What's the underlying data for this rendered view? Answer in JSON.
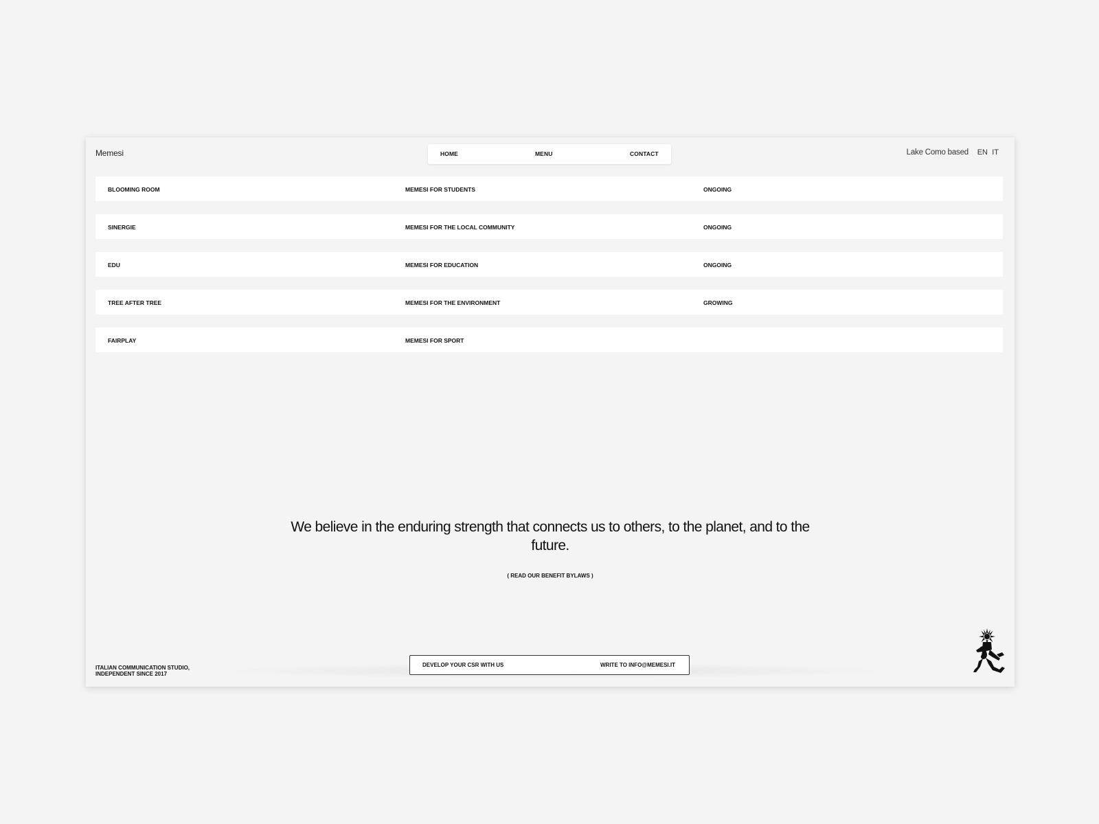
{
  "header": {
    "brand": "Memesi",
    "nav": {
      "home": "HOME",
      "menu": "MENU",
      "contact": "CONTACT"
    },
    "location": "Lake Como based",
    "languages": {
      "en": "EN",
      "it": "IT"
    }
  },
  "projects": [
    {
      "name": "BLOOMING ROOM",
      "category": "MEMESI FOR STUDENTS",
      "status": "ONGOING"
    },
    {
      "name": "SINERGIE",
      "category": "MEMESI FOR THE LOCAL COMMUNITY",
      "status": "ONGOING"
    },
    {
      "name": "EDU",
      "category": "MEMESI FOR EDUCATION",
      "status": "ONGOING"
    },
    {
      "name": "TREE AFTER TREE",
      "category": "MEMESI FOR THE ENVIRONMENT",
      "status": "GROWING"
    },
    {
      "name": "FAIRPLAY",
      "category": "MEMESI FOR SPORT",
      "status": ""
    }
  ],
  "statement": {
    "text": "We believe in the enduring strength that connects us to others, to the planet, and to the future.",
    "link": "( READ OUR BENEFIT BYLAWS )"
  },
  "footer": {
    "line1": "ITALIAN COMMUNICATION STUDIO,",
    "line2": "INDEPENDENT SINCE 2017",
    "cta_left": "DEVELOP YOUR CSR WITH US",
    "cta_right": "WRITE TO INFO@MEMESI.IT",
    "mascot_icon": "running-figure-icon"
  },
  "colors": {
    "background": "#f4f4f4",
    "surface": "#ffffff",
    "text": "#111111"
  }
}
